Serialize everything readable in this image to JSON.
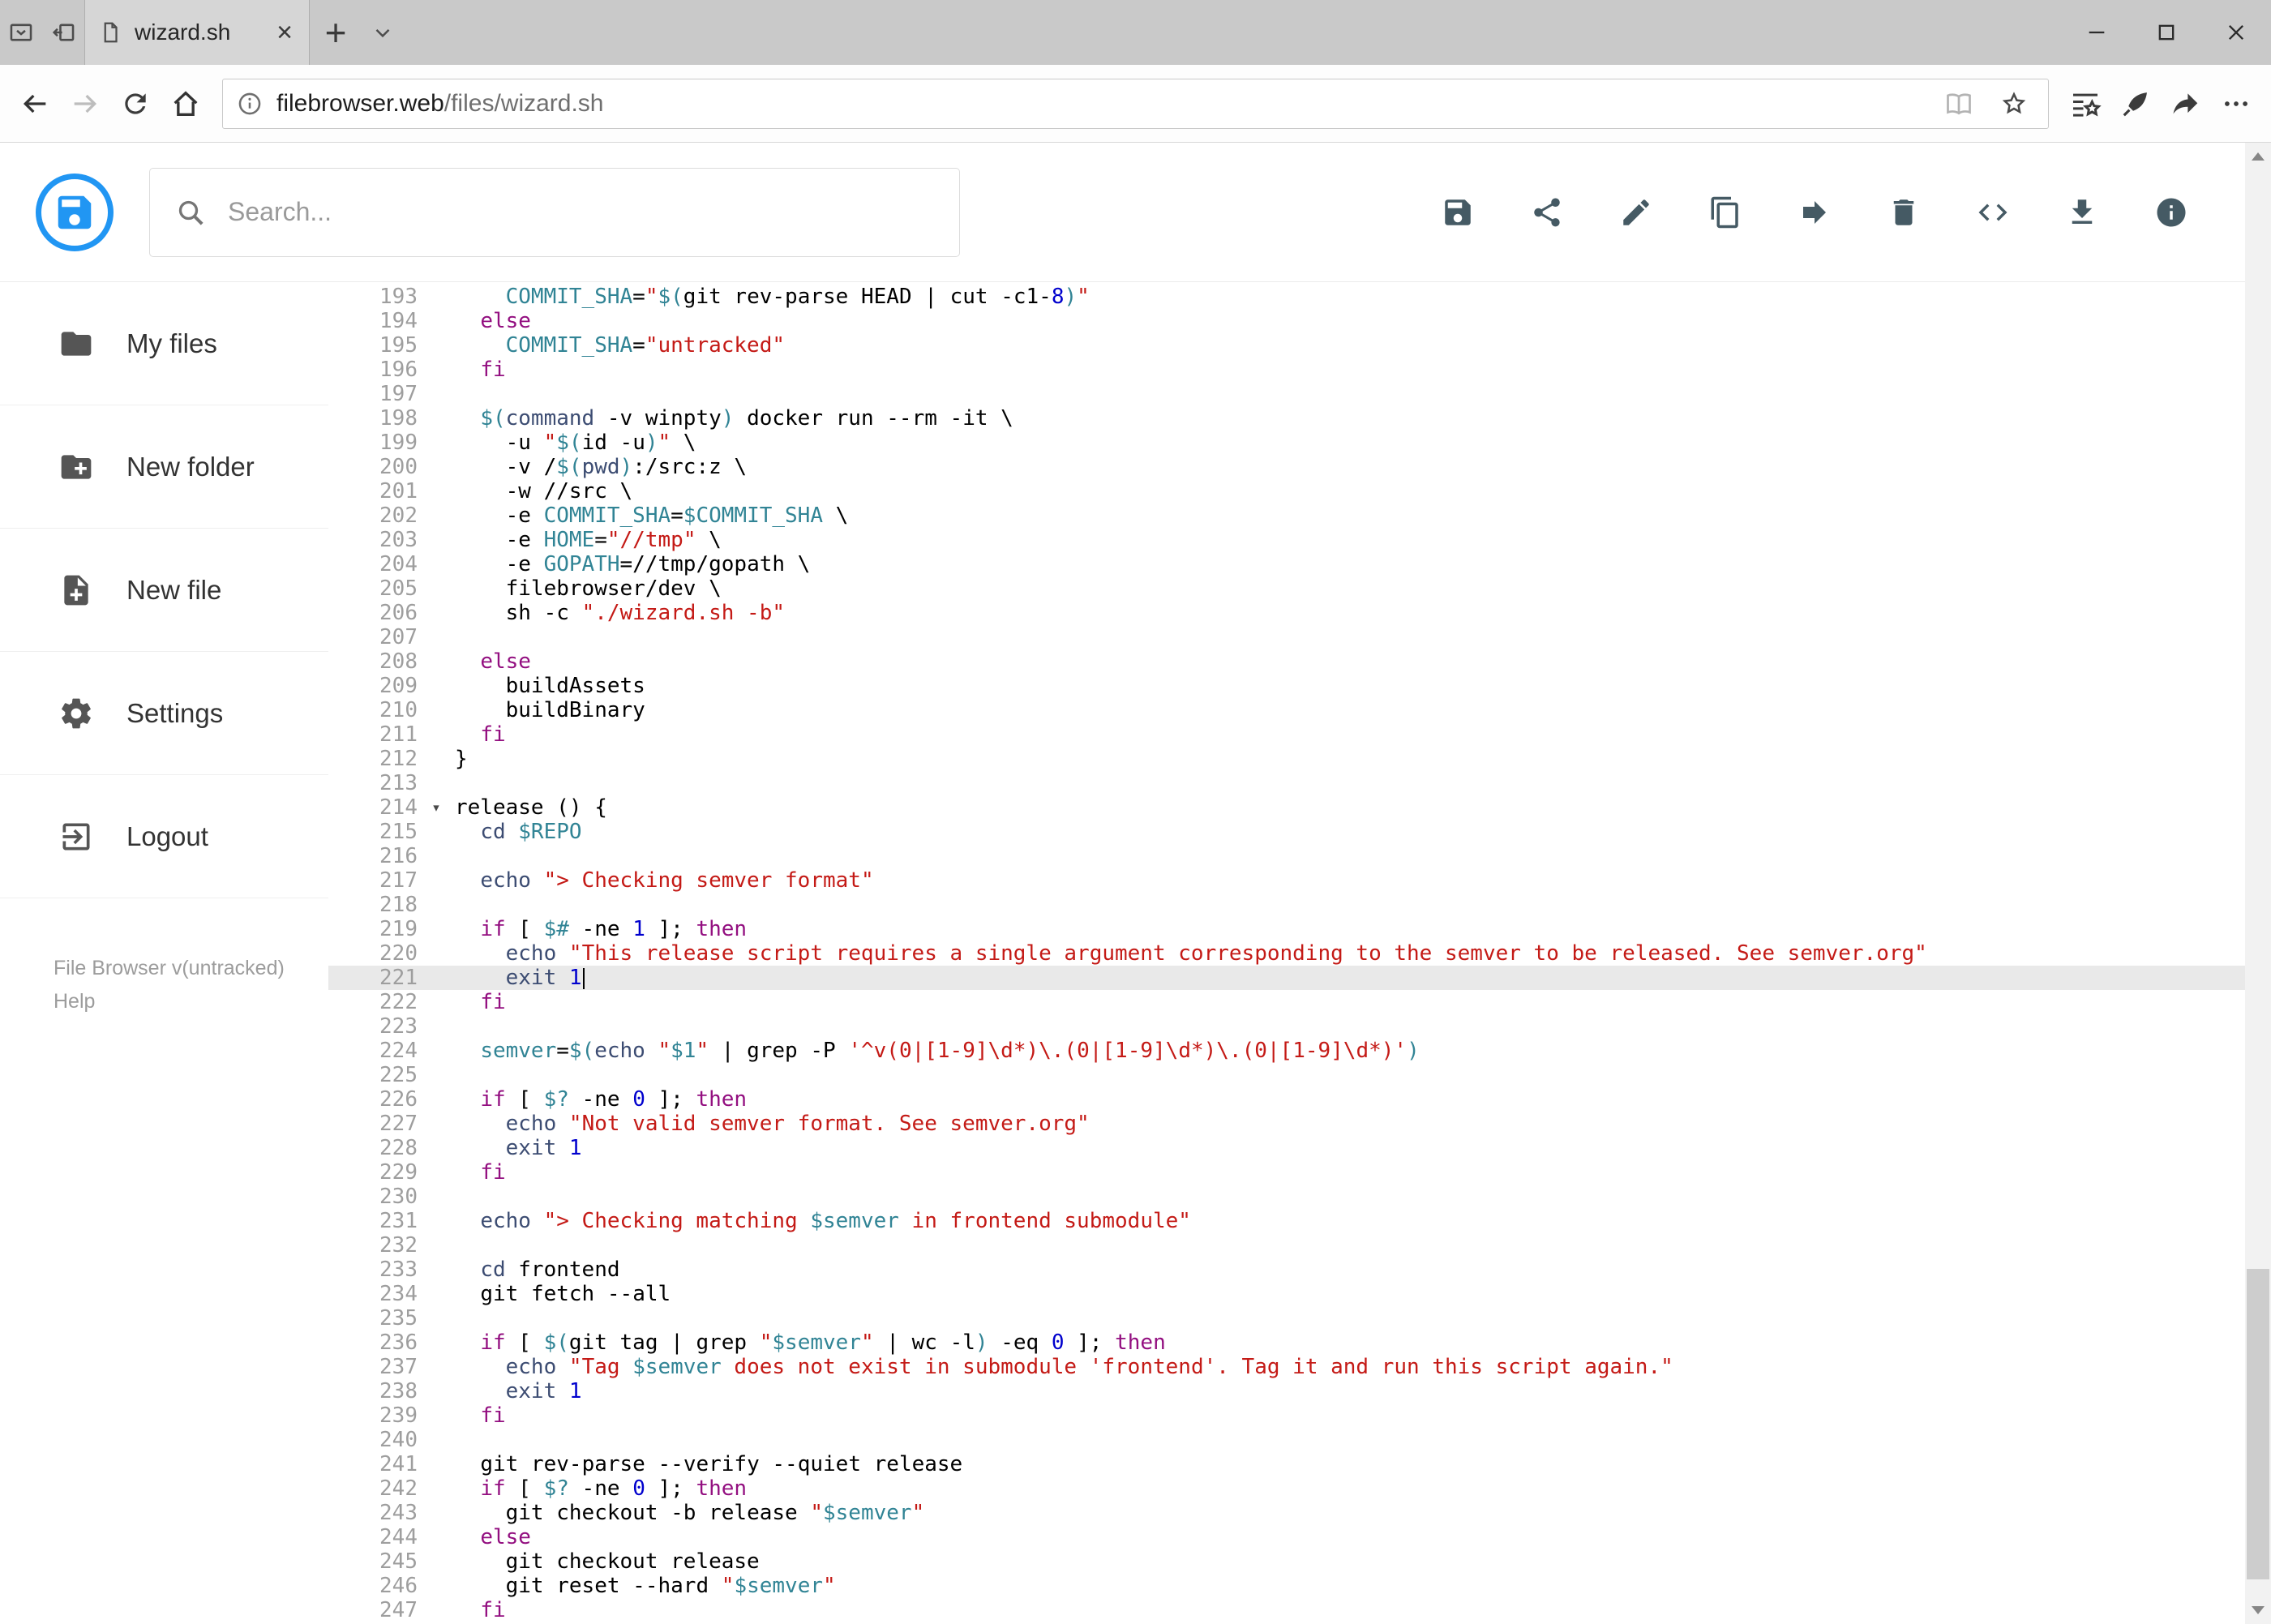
{
  "browser": {
    "tab_title": "wizard.sh",
    "url_domain": "filebrowser.web",
    "url_path": "/files/wizard.sh",
    "tabstrip_icons": [
      "tab-previews",
      "set-tabs-aside",
      "new-tab",
      "tab-menu"
    ],
    "nav_icons": [
      "back",
      "forward",
      "refresh",
      "home"
    ],
    "addressbar_icons": [
      "info",
      "reader-view",
      "favorite-star"
    ],
    "action_icons": [
      "hub",
      "web-note",
      "share",
      "more"
    ],
    "window_controls": [
      "minimize",
      "maximize",
      "close"
    ],
    "new_tab_label": "+"
  },
  "app": {
    "search_placeholder": "Search...",
    "toolbar_icons": [
      "save",
      "share",
      "edit",
      "copy",
      "move",
      "delete",
      "code",
      "download",
      "info"
    ],
    "accent_color": "#2196f3",
    "sidebar": {
      "items": [
        {
          "label": "My files",
          "icon": "folder"
        },
        {
          "label": "New folder",
          "icon": "create-new-folder"
        },
        {
          "label": "New file",
          "icon": "new-file"
        },
        {
          "label": "Settings",
          "icon": "settings"
        },
        {
          "label": "Logout",
          "icon": "logout"
        }
      ],
      "version_text": "File Browser v(untracked)",
      "help_label": "Help"
    }
  },
  "editor": {
    "language": "shell",
    "first_line_number": 193,
    "active_line_number": 221,
    "cursor": {
      "line": 221,
      "position": "end-of-line"
    },
    "fold_marker_line": 214,
    "fold_marker_glyph": "▾",
    "lines": [
      "    COMMIT_SHA=\"$(git rev-parse HEAD | cut -c1-8)\"",
      "  else",
      "    COMMIT_SHA=\"untracked\"",
      "  fi",
      "",
      "  $(command -v winpty) docker run --rm -it \\",
      "    -u \"$(id -u)\" \\",
      "    -v /$(pwd):/src:z \\",
      "    -w //src \\",
      "    -e COMMIT_SHA=$COMMIT_SHA \\",
      "    -e HOME=\"//tmp\" \\",
      "    -e GOPATH=//tmp/gopath \\",
      "    filebrowser/dev \\",
      "    sh -c \"./wizard.sh -b\"",
      "",
      "  else",
      "    buildAssets",
      "    buildBinary",
      "  fi",
      "}",
      "",
      "release () {",
      "  cd $REPO",
      "",
      "  echo \"> Checking semver format\"",
      "",
      "  if [ $# -ne 1 ]; then",
      "    echo \"This release script requires a single argument corresponding to the semver to be released. See semver.org\"",
      "    exit 1",
      "  fi",
      "",
      "  semver=$(echo \"$1\" | grep -P '^v(0|[1-9]\\d*)\\.(0|[1-9]\\d*)\\.(0|[1-9]\\d*)')",
      "",
      "  if [ $? -ne 0 ]; then",
      "    echo \"Not valid semver format. See semver.org\"",
      "    exit 1",
      "  fi",
      "",
      "  echo \"> Checking matching $semver in frontend submodule\"",
      "",
      "  cd frontend",
      "  git fetch --all",
      "",
      "  if [ $(git tag | grep \"$semver\" | wc -l) -eq 0 ]; then",
      "    echo \"Tag $semver does not exist in submodule 'frontend'. Tag it and run this script again.\"",
      "    exit 1",
      "  fi",
      "",
      "  git rev-parse --verify --quiet release",
      "  if [ $? -ne 0 ]; then",
      "    git checkout -b release \"$semver\"",
      "  else",
      "    git checkout release",
      "    git reset --hard \"$semver\"",
      "  fi"
    ],
    "syntax": {
      "keywords": [
        "if",
        "then",
        "else",
        "elif",
        "fi",
        "for",
        "while",
        "until",
        "do",
        "done",
        "in",
        "esac",
        "case",
        "function",
        "select",
        "export",
        "local"
      ],
      "builtins": [
        "echo",
        "cd",
        "exit",
        "pwd",
        "command",
        "set",
        "read",
        "shift",
        "test",
        "kill"
      ]
    },
    "colors": {
      "keyword": "#930f80",
      "string": "#c41a16",
      "variable": "#318495",
      "builtin": "#3c4c72",
      "number": "#0000cd",
      "text": "#000000",
      "line_number": "#9e9e9e",
      "active_line_bg": "#e9e9e9"
    }
  }
}
